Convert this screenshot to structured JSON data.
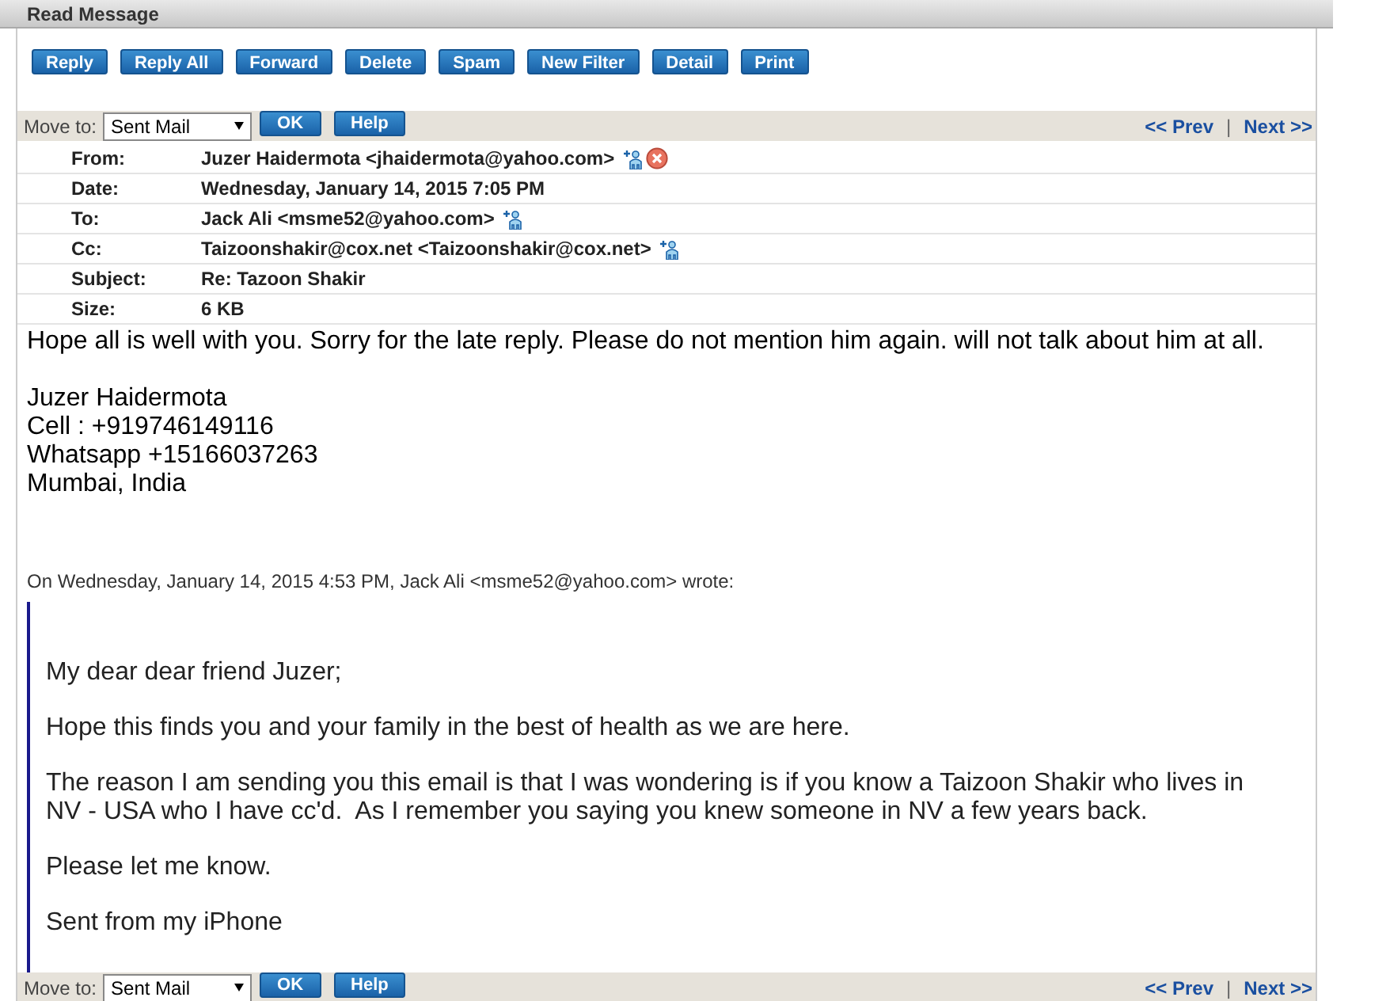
{
  "panel_title": "Read Message",
  "toolbar": [
    "Reply",
    "Reply All",
    "Forward",
    "Delete",
    "Spam",
    "New Filter",
    "Detail",
    "Print"
  ],
  "move_bars": [
    {
      "label": "Move to:",
      "folder": "Sent Mail",
      "ok": "OK",
      "help": "Help",
      "prev": "<< Prev",
      "separator": "|",
      "next": "Next >>"
    },
    {
      "label": "Move to:",
      "folder": "Sent Mail",
      "ok": "OK",
      "help": "Help",
      "prev": "<< Prev",
      "separator": "|",
      "next": "Next >>"
    }
  ],
  "headers": [
    {
      "label": "From:",
      "value": "Juzer Haidermota <jhaidermota@yahoo.com>",
      "add_contact": true,
      "block": true
    },
    {
      "label": "Date:",
      "value": "Wednesday, January 14, 2015 7:05 PM",
      "add_contact": false,
      "block": false
    },
    {
      "label": "To:",
      "value": "Jack Ali <msme52@yahoo.com>",
      "add_contact": true,
      "block": false
    },
    {
      "label": "Cc:",
      "value": "Taizoonshakir@cox.net <Taizoonshakir@cox.net>",
      "add_contact": true,
      "block": false
    },
    {
      "label": "Subject:",
      "value": "Re: Tazoon Shakir",
      "add_contact": false,
      "block": false
    },
    {
      "label": "Size:",
      "value": "6 KB",
      "add_contact": false,
      "block": false
    }
  ],
  "body": {
    "paragraphs": [
      [
        "Hope all is well with you. Sorry for the late reply. Please do not mention him again. will not talk about him at all."
      ],
      [
        "Juzer Haidermota",
        "Cell : +919746149116",
        "Whatsapp +15166037263",
        "Mumbai, India"
      ]
    ],
    "quote_header": "On Wednesday, January 14, 2015 4:53 PM, Jack Ali <msme52@yahoo.com> wrote:",
    "quote": [
      [
        "My dear dear friend Juzer;"
      ],
      [
        "Hope this finds you and your family in the best of health as we are here."
      ],
      [
        "The reason I am sending you this email is that I was wondering is if you know a Taizoon Shakir who lives in",
        "NV - USA who I have cc'd.  As I remember you saying you knew someone in NV a few years back."
      ],
      [
        "Please let me know."
      ],
      [
        "Sent from my iPhone"
      ]
    ]
  }
}
